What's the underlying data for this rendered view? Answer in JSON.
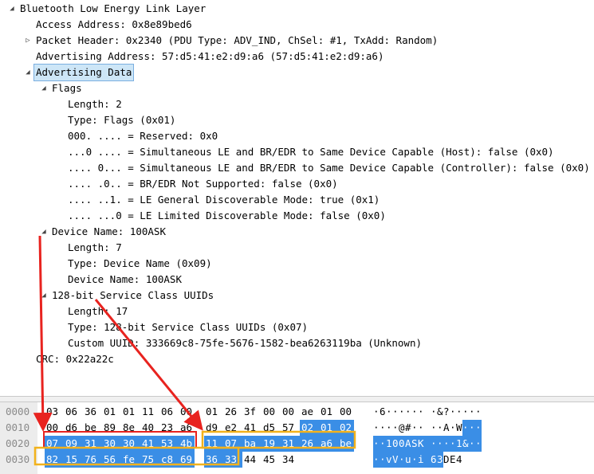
{
  "tree": [
    {
      "text": "Bluetooth Low Energy Link Layer",
      "depth": 0,
      "toggle": "expanded",
      "selected": false
    },
    {
      "text": "Access Address: 0x8e89bed6",
      "depth": 1,
      "toggle": "none",
      "selected": false
    },
    {
      "text": "Packet Header: 0x2340 (PDU Type: ADV_IND, ChSel: #1, TxAdd: Random)",
      "depth": 1,
      "toggle": "collapsed",
      "selected": false
    },
    {
      "text": "Advertising Address: 57:d5:41:e2:d9:a6 (57:d5:41:e2:d9:a6)",
      "depth": 1,
      "toggle": "none",
      "selected": false
    },
    {
      "text": "Advertising Data",
      "depth": 1,
      "toggle": "expanded",
      "selected": true
    },
    {
      "text": "Flags",
      "depth": 2,
      "toggle": "expanded",
      "selected": false
    },
    {
      "text": "Length: 2",
      "depth": 3,
      "toggle": "none",
      "selected": false
    },
    {
      "text": "Type: Flags (0x01)",
      "depth": 3,
      "toggle": "none",
      "selected": false
    },
    {
      "text": "000. .... = Reserved: 0x0",
      "depth": 3,
      "toggle": "none",
      "selected": false
    },
    {
      "text": "...0 .... = Simultaneous LE and BR/EDR to Same Device Capable (Host): false (0x0)",
      "depth": 3,
      "toggle": "none",
      "selected": false
    },
    {
      "text": ".... 0... = Simultaneous LE and BR/EDR to Same Device Capable (Controller): false (0x0)",
      "depth": 3,
      "toggle": "none",
      "selected": false
    },
    {
      "text": ".... .0.. = BR/EDR Not Supported: false (0x0)",
      "depth": 3,
      "toggle": "none",
      "selected": false
    },
    {
      "text": ".... ..1. = LE General Discoverable Mode: true (0x1)",
      "depth": 3,
      "toggle": "none",
      "selected": false
    },
    {
      "text": ".... ...0 = LE Limited Discoverable Mode: false (0x0)",
      "depth": 3,
      "toggle": "none",
      "selected": false
    },
    {
      "text": "Device Name: 100ASK",
      "depth": 2,
      "toggle": "expanded",
      "selected": false
    },
    {
      "text": "Length: 7",
      "depth": 3,
      "toggle": "none",
      "selected": false
    },
    {
      "text": "Type: Device Name (0x09)",
      "depth": 3,
      "toggle": "none",
      "selected": false
    },
    {
      "text": "Device Name: 100ASK",
      "depth": 3,
      "toggle": "none",
      "selected": false
    },
    {
      "text": "128-bit Service Class UUIDs",
      "depth": 2,
      "toggle": "expanded",
      "selected": false
    },
    {
      "text": "Length: 17",
      "depth": 3,
      "toggle": "none",
      "selected": false
    },
    {
      "text": "Type: 128-bit Service Class UUIDs (0x07)",
      "depth": 3,
      "toggle": "none",
      "selected": false
    },
    {
      "text": "Custom UUID: 333669c8-75fe-5676-1582-bea6263119ba (Unknown)",
      "depth": 3,
      "toggle": "none",
      "selected": false
    },
    {
      "text": "CRC: 0x22a22c",
      "depth": 1,
      "toggle": "none",
      "selected": false
    }
  ],
  "hex_rows": [
    {
      "offset": "0000",
      "bytes": [
        "03",
        "06",
        "36",
        "01",
        "01",
        "11",
        "06",
        "00",
        "01",
        "26",
        "3f",
        "00",
        "00",
        "ae",
        "01",
        "00"
      ],
      "hl": [],
      "ascii": [
        "·",
        "6",
        "·",
        "·",
        "·",
        "·",
        "·",
        "·",
        "·",
        "&",
        "?",
        "·",
        "·",
        "·",
        "·",
        "·"
      ],
      "ascii_hl": []
    },
    {
      "offset": "0010",
      "bytes": [
        "00",
        "d6",
        "be",
        "89",
        "8e",
        "40",
        "23",
        "a6",
        "d9",
        "e2",
        "41",
        "d5",
        "57",
        "02",
        "01",
        "02"
      ],
      "hl": [
        13,
        14,
        15
      ],
      "ascii": [
        "·",
        "·",
        "·",
        "·",
        "@",
        "#",
        "·",
        "·",
        "·",
        "·",
        "A",
        "·",
        "W",
        "·",
        "·",
        "·"
      ],
      "ascii_hl": [
        13,
        14,
        15
      ]
    },
    {
      "offset": "0020",
      "bytes": [
        "07",
        "09",
        "31",
        "30",
        "30",
        "41",
        "53",
        "4b",
        "11",
        "07",
        "ba",
        "19",
        "31",
        "26",
        "a6",
        "be"
      ],
      "hl": [
        0,
        1,
        2,
        3,
        4,
        5,
        6,
        7,
        8,
        9,
        10,
        11,
        12,
        13,
        14,
        15
      ],
      "ascii": [
        "·",
        "·",
        "1",
        "0",
        "0",
        "A",
        "S",
        "K",
        "·",
        "·",
        "·",
        "·",
        "1",
        "&",
        "·",
        "·"
      ],
      "ascii_hl": [
        0,
        1,
        2,
        3,
        4,
        5,
        6,
        7,
        8,
        9,
        10,
        11,
        12,
        13,
        14,
        15
      ]
    },
    {
      "offset": "0030",
      "bytes": [
        "82",
        "15",
        "76",
        "56",
        "fe",
        "75",
        "c8",
        "69",
        "36",
        "33",
        "44",
        "45",
        "34"
      ],
      "hl": [
        0,
        1,
        2,
        3,
        4,
        5,
        6,
        7,
        8,
        9
      ],
      "ascii": [
        "·",
        "·",
        "v",
        "V",
        "·",
        "u",
        "·",
        "i",
        "6",
        "3",
        "D",
        "E",
        "4"
      ],
      "ascii_hl": [
        0,
        1,
        2,
        3,
        4,
        5,
        6,
        7,
        8,
        9
      ]
    }
  ],
  "colors": {
    "highlight": "#3a8ee6",
    "selection": "#cde6f7",
    "annotation_red": "#e8231f",
    "annotation_orange": "#f2b21c"
  }
}
